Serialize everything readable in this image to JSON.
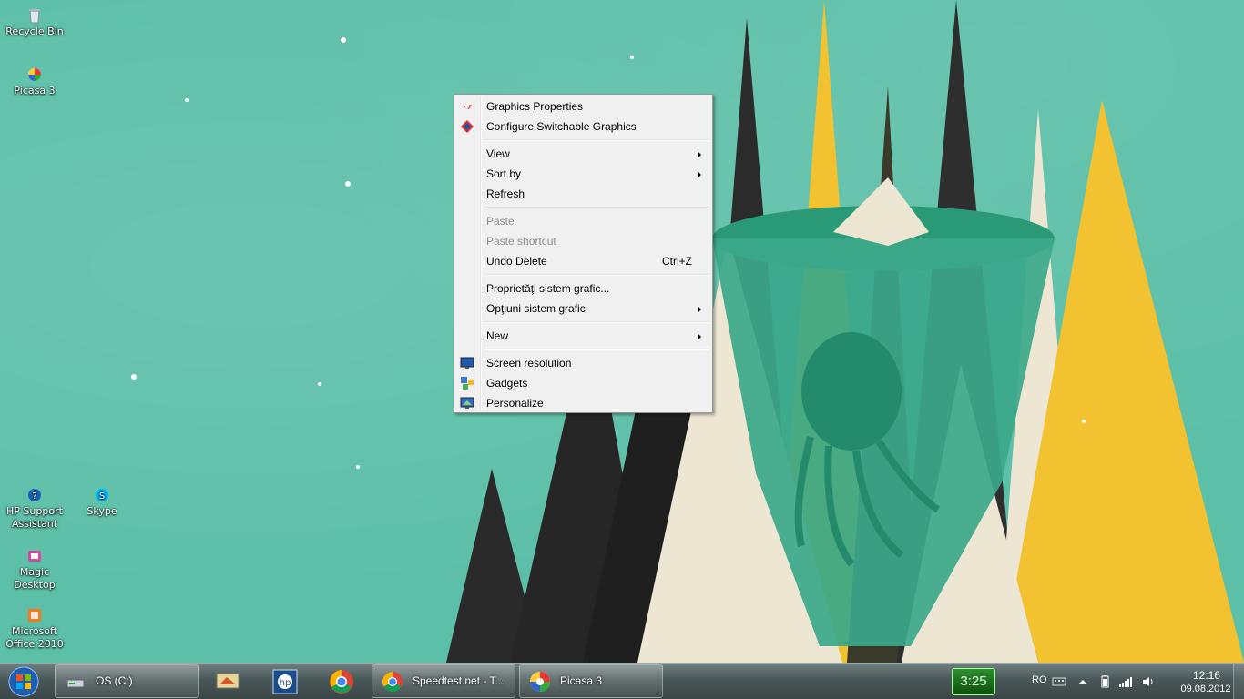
{
  "desktop_icons": [
    {
      "label": "Recycle Bin",
      "icon": "recycle-bin-icon"
    },
    {
      "label": "Picasa 3",
      "icon": "picasa-icon"
    },
    {
      "label": "HP Support Assistant",
      "icon": "hp-support-icon"
    },
    {
      "label": "Skype",
      "icon": "skype-icon"
    },
    {
      "label": "Magic Desktop",
      "icon": "magic-desktop-icon"
    },
    {
      "label": "Microsoft Office 2010",
      "icon": "office-icon"
    }
  ],
  "context_menu": {
    "items": {
      "graphics_properties": "Graphics Properties",
      "configure_switchable": "Configure Switchable Graphics",
      "view": "View",
      "sort_by": "Sort by",
      "refresh": "Refresh",
      "paste": "Paste",
      "paste_shortcut": "Paste shortcut",
      "undo_delete": "Undo Delete",
      "undo_delete_shortcut": "Ctrl+Z",
      "proprietati": "Proprietăţi sistem grafic...",
      "optiuni": "Opţiuni sistem grafic",
      "new": "New",
      "screen_resolution": "Screen resolution",
      "gadgets": "Gadgets",
      "personalize": "Personalize"
    }
  },
  "taskbar": {
    "explorer_label": "OS (C:)",
    "chrome_window_label": "Speedtest.net - T...",
    "picasa_window_label": "Picasa 3",
    "clock_gadget": "3:25",
    "language": "RO",
    "time": "12:16",
    "date": "09.08.2012"
  },
  "colors": {
    "wallpaper_teal": "#5cbfa7",
    "wallpaper_yellow": "#f2c230",
    "wallpaper_black": "#2b2b2b",
    "wallpaper_cream": "#ece6d2",
    "menu_bg": "#f0f0f0"
  }
}
